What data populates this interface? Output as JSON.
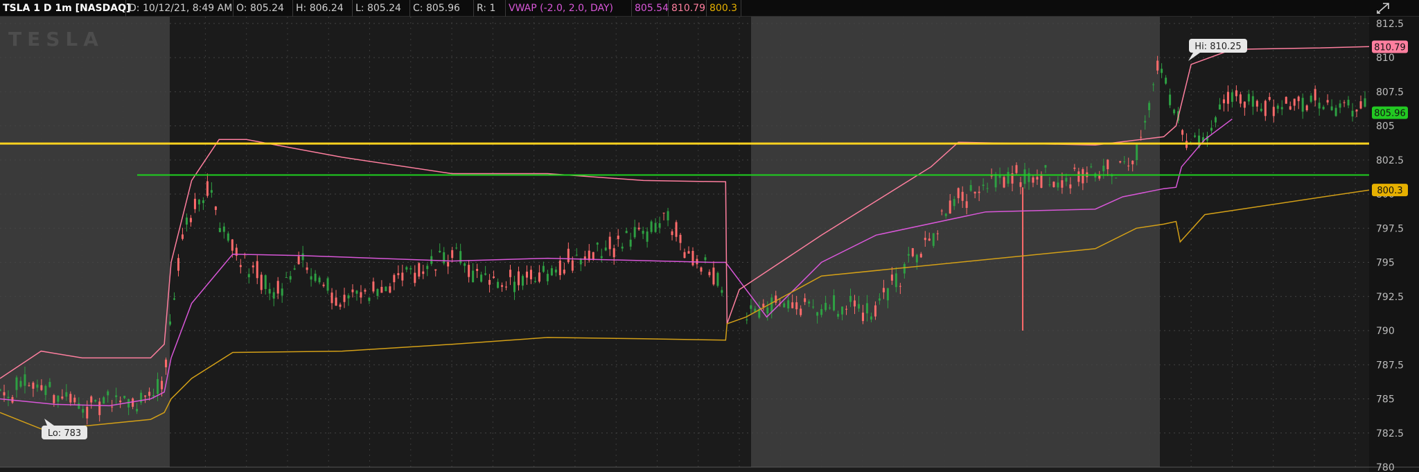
{
  "header": {
    "symbol": "TSLA 1 D 1m [NASDAQ]",
    "date": "D: 10/12/21, 8:49 AM",
    "open": "O: 805.24",
    "high": "H: 806.24",
    "low": "L: 805.24",
    "close": "C: 805.96",
    "range": "R: 1",
    "vwap_label": "VWAP (-2.0, 2.0, DAY)",
    "vwap_value": "805.54",
    "vwap_upper": "810.79",
    "vwap_lower": "800.3"
  },
  "watermark": "TESLA",
  "colors": {
    "background": "#1b1b1b",
    "session_shade": "#3a3a3a",
    "up_candle": "#2ea043",
    "down_candle": "#ff6b6b",
    "vwap": "#d957d9",
    "upper_band": "#ff7f9f",
    "lower_band": "#d4a017",
    "resistance": "#ffd21f",
    "support": "#1fd11f",
    "last_price": "#22c922"
  },
  "chart_data": {
    "type": "candlestick",
    "y_axis": {
      "min": 780,
      "max": 813,
      "ticks": [
        780,
        782.5,
        785,
        787.5,
        790,
        792.5,
        795,
        797.5,
        800,
        802.5,
        805,
        807.5,
        810,
        812.5
      ]
    },
    "annotations": {
      "high_label": "Hi: 810.25",
      "low_label": "Lo: 783",
      "high": 810.25,
      "low": 783
    },
    "horizontal_lines": [
      {
        "name": "resistance",
        "value": 803.7
      },
      {
        "name": "support",
        "value": 801.4
      }
    ],
    "price_tags": [
      {
        "label": "810.79",
        "value": 810.79,
        "color": "#ff7f9f"
      },
      {
        "label": "805.96",
        "value": 805.96,
        "color": "#22c922"
      },
      {
        "label": "800.3",
        "value": 800.3,
        "color": "#e6b000"
      }
    ],
    "series": [
      {
        "name": "VWAP",
        "x": [
          0,
          40,
          80,
          110,
          120,
          125,
          140,
          170,
          220,
          330,
          400,
          520,
          530,
          560,
          600,
          640,
          720,
          800,
          820,
          850,
          859,
          863,
          880,
          900
        ],
        "values": [
          785,
          784.6,
          784.5,
          785,
          785.5,
          788,
          792,
          795.6,
          795.5,
          795.1,
          795.3,
          795,
          795,
          791,
          795,
          797,
          798.7,
          798.9,
          799.8,
          800.4,
          800.5,
          802,
          804,
          805.5
        ]
      },
      {
        "name": "Upper",
        "x": [
          0,
          30,
          60,
          110,
          120,
          125,
          140,
          160,
          180,
          250,
          330,
          400,
          470,
          530,
          531,
          540,
          600,
          680,
          700,
          800,
          850,
          859,
          870,
          900,
          960,
          1000
        ],
        "values": [
          786.5,
          788.5,
          788,
          788,
          789,
          795,
          801,
          804,
          804,
          802.7,
          801.5,
          801.5,
          801,
          800.9,
          790.5,
          793,
          797,
          802,
          803.8,
          803.6,
          804.2,
          805,
          809.5,
          810.6,
          810.7,
          810.8
        ]
      },
      {
        "name": "Lower",
        "x": [
          0,
          30,
          60,
          110,
          120,
          125,
          140,
          170,
          250,
          330,
          400,
          470,
          530,
          531,
          545,
          600,
          700,
          800,
          830,
          850,
          859,
          862,
          880,
          900,
          1000
        ],
        "values": [
          784,
          782.8,
          783,
          783.5,
          784,
          785,
          786.5,
          788.4,
          788.5,
          789,
          789.5,
          789.4,
          789.3,
          790.5,
          791,
          794,
          795,
          796,
          797.5,
          797.8,
          798,
          796.5,
          798.5,
          798.8,
          800.3
        ]
      }
    ]
  }
}
